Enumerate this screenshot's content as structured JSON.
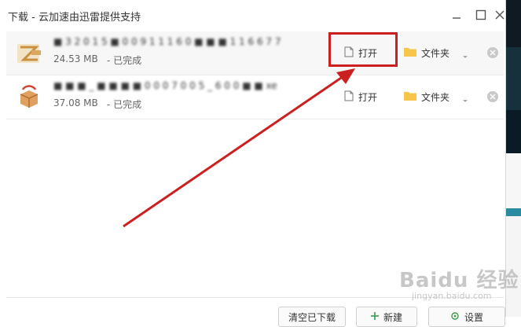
{
  "window": {
    "title": "下载 - 云加速由迅雷提供支持"
  },
  "downloads": [
    {
      "filename": "■ 3 2 0 1 5 ■ 0 0 9 1 1 1 6 0 ■ ■ ■ 1 1 6 6 7 7",
      "size": "24.53 MB",
      "status": "- 已完成",
      "open_label": "打开",
      "folder_label": "文件夹"
    },
    {
      "filename": "■ ■ ■ _ ■ ■ ■ ■ 0 0 0 7 0 0 5 _ 6 0 0 ■ ■ xe",
      "size": "37.08 MB",
      "status": "- 已完成",
      "open_label": "打开",
      "folder_label": "文件夹"
    }
  ],
  "footer": {
    "clear_label": "清空已下载",
    "new_label": "新建",
    "settings_label": "设置"
  },
  "watermark": {
    "main": "Baidu 经验",
    "sub": "jingyan.baidu.com"
  },
  "colors": {
    "annotation": "#cc2020",
    "folder": "#f5c64a"
  }
}
